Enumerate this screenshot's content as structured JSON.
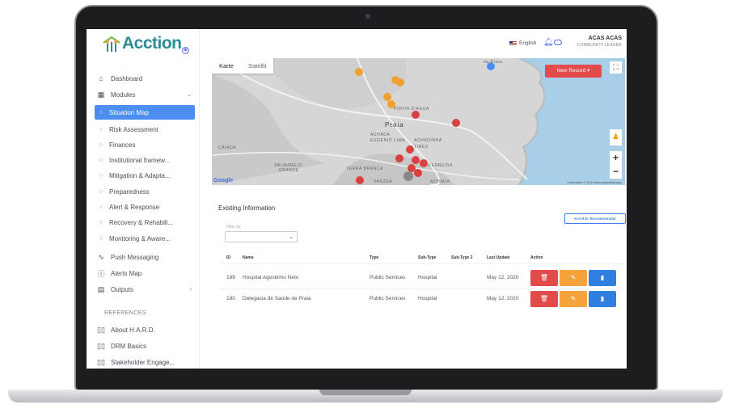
{
  "brand": {
    "name": "Acction"
  },
  "sidebar": {
    "items": [
      {
        "label": "Dashboard",
        "icon": "home-icon"
      },
      {
        "label": "Modules",
        "icon": "grid-icon"
      },
      {
        "label": "Situation Map",
        "active": true
      },
      {
        "label": "Risk Assessment"
      },
      {
        "label": "Finances"
      },
      {
        "label": "Institutional framew..."
      },
      {
        "label": "Mitigation & Adapta..."
      },
      {
        "label": "Preparedness"
      },
      {
        "label": "Alert & Response"
      },
      {
        "label": "Recovery & Rehabili..."
      },
      {
        "label": "Monitoring & Aware..."
      },
      {
        "label": "Push Messaging",
        "icon": "pulse-icon"
      },
      {
        "label": "Alerts Map",
        "icon": "info-icon"
      },
      {
        "label": "Outputs",
        "icon": "document-icon"
      }
    ],
    "references_heading": "REFERENCES",
    "references": [
      {
        "label": "About H.A.R.D."
      },
      {
        "label": "DRM Basics"
      },
      {
        "label": "Stakeholder Engage..."
      }
    ]
  },
  "topbar": {
    "language": "English",
    "user_name": "ACAS ACAS",
    "user_role": "COMMUNITY LEADER"
  },
  "map": {
    "tabs": [
      "Karte",
      "Satellit"
    ],
    "new_record": "New Record ▾",
    "labels": [
      "Praia",
      "ACHADA",
      "EUGENIO LIMA",
      "ACHADINHA",
      "PALMAREJO GRANDE",
      "TERRA BRANCA",
      "FERREIRA",
      "CAIADA",
      "VARZEA",
      "ACHADA",
      "da Praia",
      "TIRES",
      "PONTA D'AGUA"
    ],
    "google": "Google",
    "credit": "Kartendaten © 2020  Nutzungsbedingungen"
  },
  "panel": {
    "title": "Existing Information",
    "hard_button": "H.A.R.D. Recommendati",
    "filter_label": "Filter by",
    "columns": [
      "ID",
      "Name",
      "Type",
      "Sub-Type",
      "Sub-Type 2",
      "Last Update",
      "Action"
    ],
    "rows": [
      {
        "id": "189",
        "name": "Hospital Agostinho Neto",
        "type": "Public Services",
        "subtype": "Hospital",
        "subtype2": "",
        "updated": "May 12, 2020"
      },
      {
        "id": "190",
        "name": "Delegacia de Saúde de Praia",
        "type": "Public Services",
        "subtype": "Hospital",
        "subtype2": "",
        "updated": "May 12, 2020"
      }
    ]
  },
  "colors": {
    "brand": "#2a8c94",
    "accent": "#4b8ef0",
    "danger": "#e34a4a",
    "warning": "#f5a23a",
    "primary": "#2f7fe0"
  }
}
